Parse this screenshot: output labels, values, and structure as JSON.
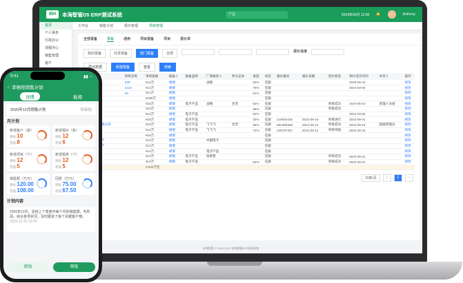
{
  "laptop": {
    "app_title": "本海智管D5 ERP测试系统",
    "search_placeholder": "产品",
    "clock": "2024年06月 12:00",
    "user": "Anthony",
    "sidebar": [
      "首页",
      "个人事务",
      "行政办公",
      "流程中心",
      "销售管理",
      "客户",
      "商机",
      "合同",
      "项目",
      "采购",
      "库存",
      "财务",
      "人事",
      "报表"
    ],
    "tabs": [
      "工作台",
      "销售计划",
      "报价管理",
      "项目管理"
    ],
    "subtabs": [
      "全部报备",
      "报备",
      "通用",
      "项目报备",
      "项目",
      "报价单"
    ],
    "filters": [
      "我的报备",
      "共享报备",
      "部门报备",
      "全部"
    ],
    "filter_label": "报价进度",
    "buttons": {
      "export": "导出数据",
      "add": "新建报备",
      "reset": "重置",
      "search": "搜索"
    },
    "table": {
      "headers": [
        "客户简称",
        "项目名称",
        "项目金额",
        "报备人",
        "报备品牌",
        "厂家联系人",
        "参与竞争",
        "进度",
        "状态",
        "报价编号",
        "报价日期",
        "签约状态",
        "预计成交时间",
        "共享人",
        "操作"
      ],
      "rows": [
        [
          "通讯文化",
          "S38",
          "¥14万",
          "胡瑞",
          "",
          "战略",
          "",
          "62%",
          "在跟",
          "",
          "",
          "",
          "2020-05-10",
          "",
          "修改"
        ],
        [
          "通讯文化",
          "S424",
          "¥14万",
          "胡瑞",
          "",
          "",
          "",
          "76%",
          "在跟",
          "",
          "",
          "",
          "2024-03-05",
          "",
          "修改"
        ],
        [
          "通讯文化",
          "S0",
          "¥14万",
          "胡瑞",
          "",
          "",
          "",
          "81%",
          "在跟",
          "",
          "",
          "",
          "",
          "",
          "修改"
        ],
        [
          "通讯文化",
          "",
          "¥188万",
          "胡瑞",
          "",
          "",
          "",
          "",
          "在跟",
          "",
          "",
          "",
          "",
          "",
          "修改"
        ],
        [
          "通讯文化",
          "",
          "¥16万",
          "胡瑞",
          "电子产品",
          "战略",
          "合无",
          "82%",
          "在跟",
          "",
          "",
          "项目成功",
          "2024-05-10",
          "管理人员组",
          "修改"
        ],
        [
          "通讯文化",
          "",
          "¥16万",
          "胡瑞",
          "",
          "",
          "",
          "95%",
          "在跟",
          "",
          "",
          "项目成功",
          "",
          "",
          "修改"
        ],
        [
          "通讯文化",
          "",
          "¥14万",
          "胡瑞",
          "电子产品",
          "",
          "",
          "62%",
          "在跟",
          "",
          "",
          "",
          "2024-03-05",
          "",
          "修改"
        ],
        [
          "通讯文化",
          "",
          "¥18万",
          "胡瑞",
          "电子产品",
          "",
          "",
          "33%",
          "在跟",
          "219924426",
          "2024-09-16",
          "项目进行",
          "2024-09-01",
          "",
          "修改"
        ],
        [
          "知能生活有限公司",
          "",
          "¥16万",
          "胡瑞",
          "电子产品",
          "飞飞飞",
          "合无",
          "95%",
          "在跟",
          "894468455",
          "2024-09-16",
          "项目成功",
          "2024-09-16",
          "超级管理员",
          "修改"
        ],
        [
          "通讯文化",
          "",
          "¥14万",
          "胡瑞",
          "电子产品",
          "飞飞飞",
          "",
          "72%",
          "在跟",
          "245787457",
          "2024-09-12",
          "项目待跟",
          "2024-09-16",
          "",
          "修改"
        ],
        [
          "通讯文化",
          "",
          "¥16万",
          "胡瑞",
          "",
          "",
          "",
          "",
          "在跟",
          "",
          "",
          "",
          "",
          "",
          "修改"
        ],
        [
          "在跟宣传客户",
          "",
          "¥14万",
          "胡瑞",
          "",
          "中国电子",
          "",
          "",
          "在跟",
          "",
          "",
          "",
          "",
          "",
          "修改"
        ],
        [
          "在跟宣传客户",
          "",
          "¥14万",
          "胡瑞",
          "",
          "",
          "",
          "",
          "在跟",
          "",
          "",
          "",
          "",
          "",
          "修改"
        ],
        [
          "茶来生活",
          "",
          "¥14万",
          "胡瑞",
          "",
          "电子产品",
          "",
          "",
          "在跟",
          "",
          "",
          "",
          "",
          "",
          "修改"
        ],
        [
          "通讯文化",
          "",
          "¥14万",
          "胡瑞",
          "电子产品",
          "张紫萱",
          "",
          "",
          "在跟",
          "",
          "",
          "项目成功",
          "2024-08-21",
          "",
          "修改"
        ],
        [
          "通讯文化",
          "",
          "¥14万",
          "胡瑞",
          "电子产品",
          "",
          "",
          "62%",
          "在跟",
          "",
          "",
          "项目成功",
          "2024-08-21",
          "",
          "修改"
        ]
      ],
      "total": "¥ 532万元"
    },
    "pager": {
      "size": "20条/页",
      "page": "1"
    },
    "footer": "本海智管 © 2018-2024 本海智管ERP测试系统"
  },
  "phone": {
    "time": "9:41",
    "title": "李杨阳销售计划",
    "tabs": [
      "详情",
      "批阅"
    ],
    "period": "2020年12月销售计划",
    "period_tag": "待审批",
    "section_monthly": "月计划",
    "kpis": [
      {
        "label": "新增客户（家）",
        "sub1": "目标",
        "v1": "10",
        "sub2": "完成",
        "v2": "8"
      },
      {
        "label": "新增报价（条）",
        "sub1": "目标",
        "v1": "12",
        "sub2": "完成",
        "v2": "6"
      },
      {
        "label": "新增项目（个）",
        "sub1": "目标",
        "v1": "12",
        "sub2": "完成",
        "v2": "5"
      },
      {
        "label": "新增报表（个）",
        "sub1": "目标",
        "v1": "12",
        "sub2": "完成",
        "v2": "5"
      },
      {
        "label": "销售额（万元）",
        "sub1": "目标",
        "v1": "120.00",
        "sub2": "完成",
        "v2": "108.00"
      },
      {
        "label": "回款（万元）",
        "sub1": "目标",
        "v1": "75.00",
        "sub2": "完成",
        "v2": "67.50"
      }
    ],
    "section_content": "计划内容",
    "content": "2020年12月，总结上个季度中每个月的销售额、毛利润，综合各项状况，及时跟进了各个关键客户端。",
    "date": "2020-12-15 15:00",
    "buttons": {
      "edit": "修改",
      "approve": "审批"
    }
  }
}
